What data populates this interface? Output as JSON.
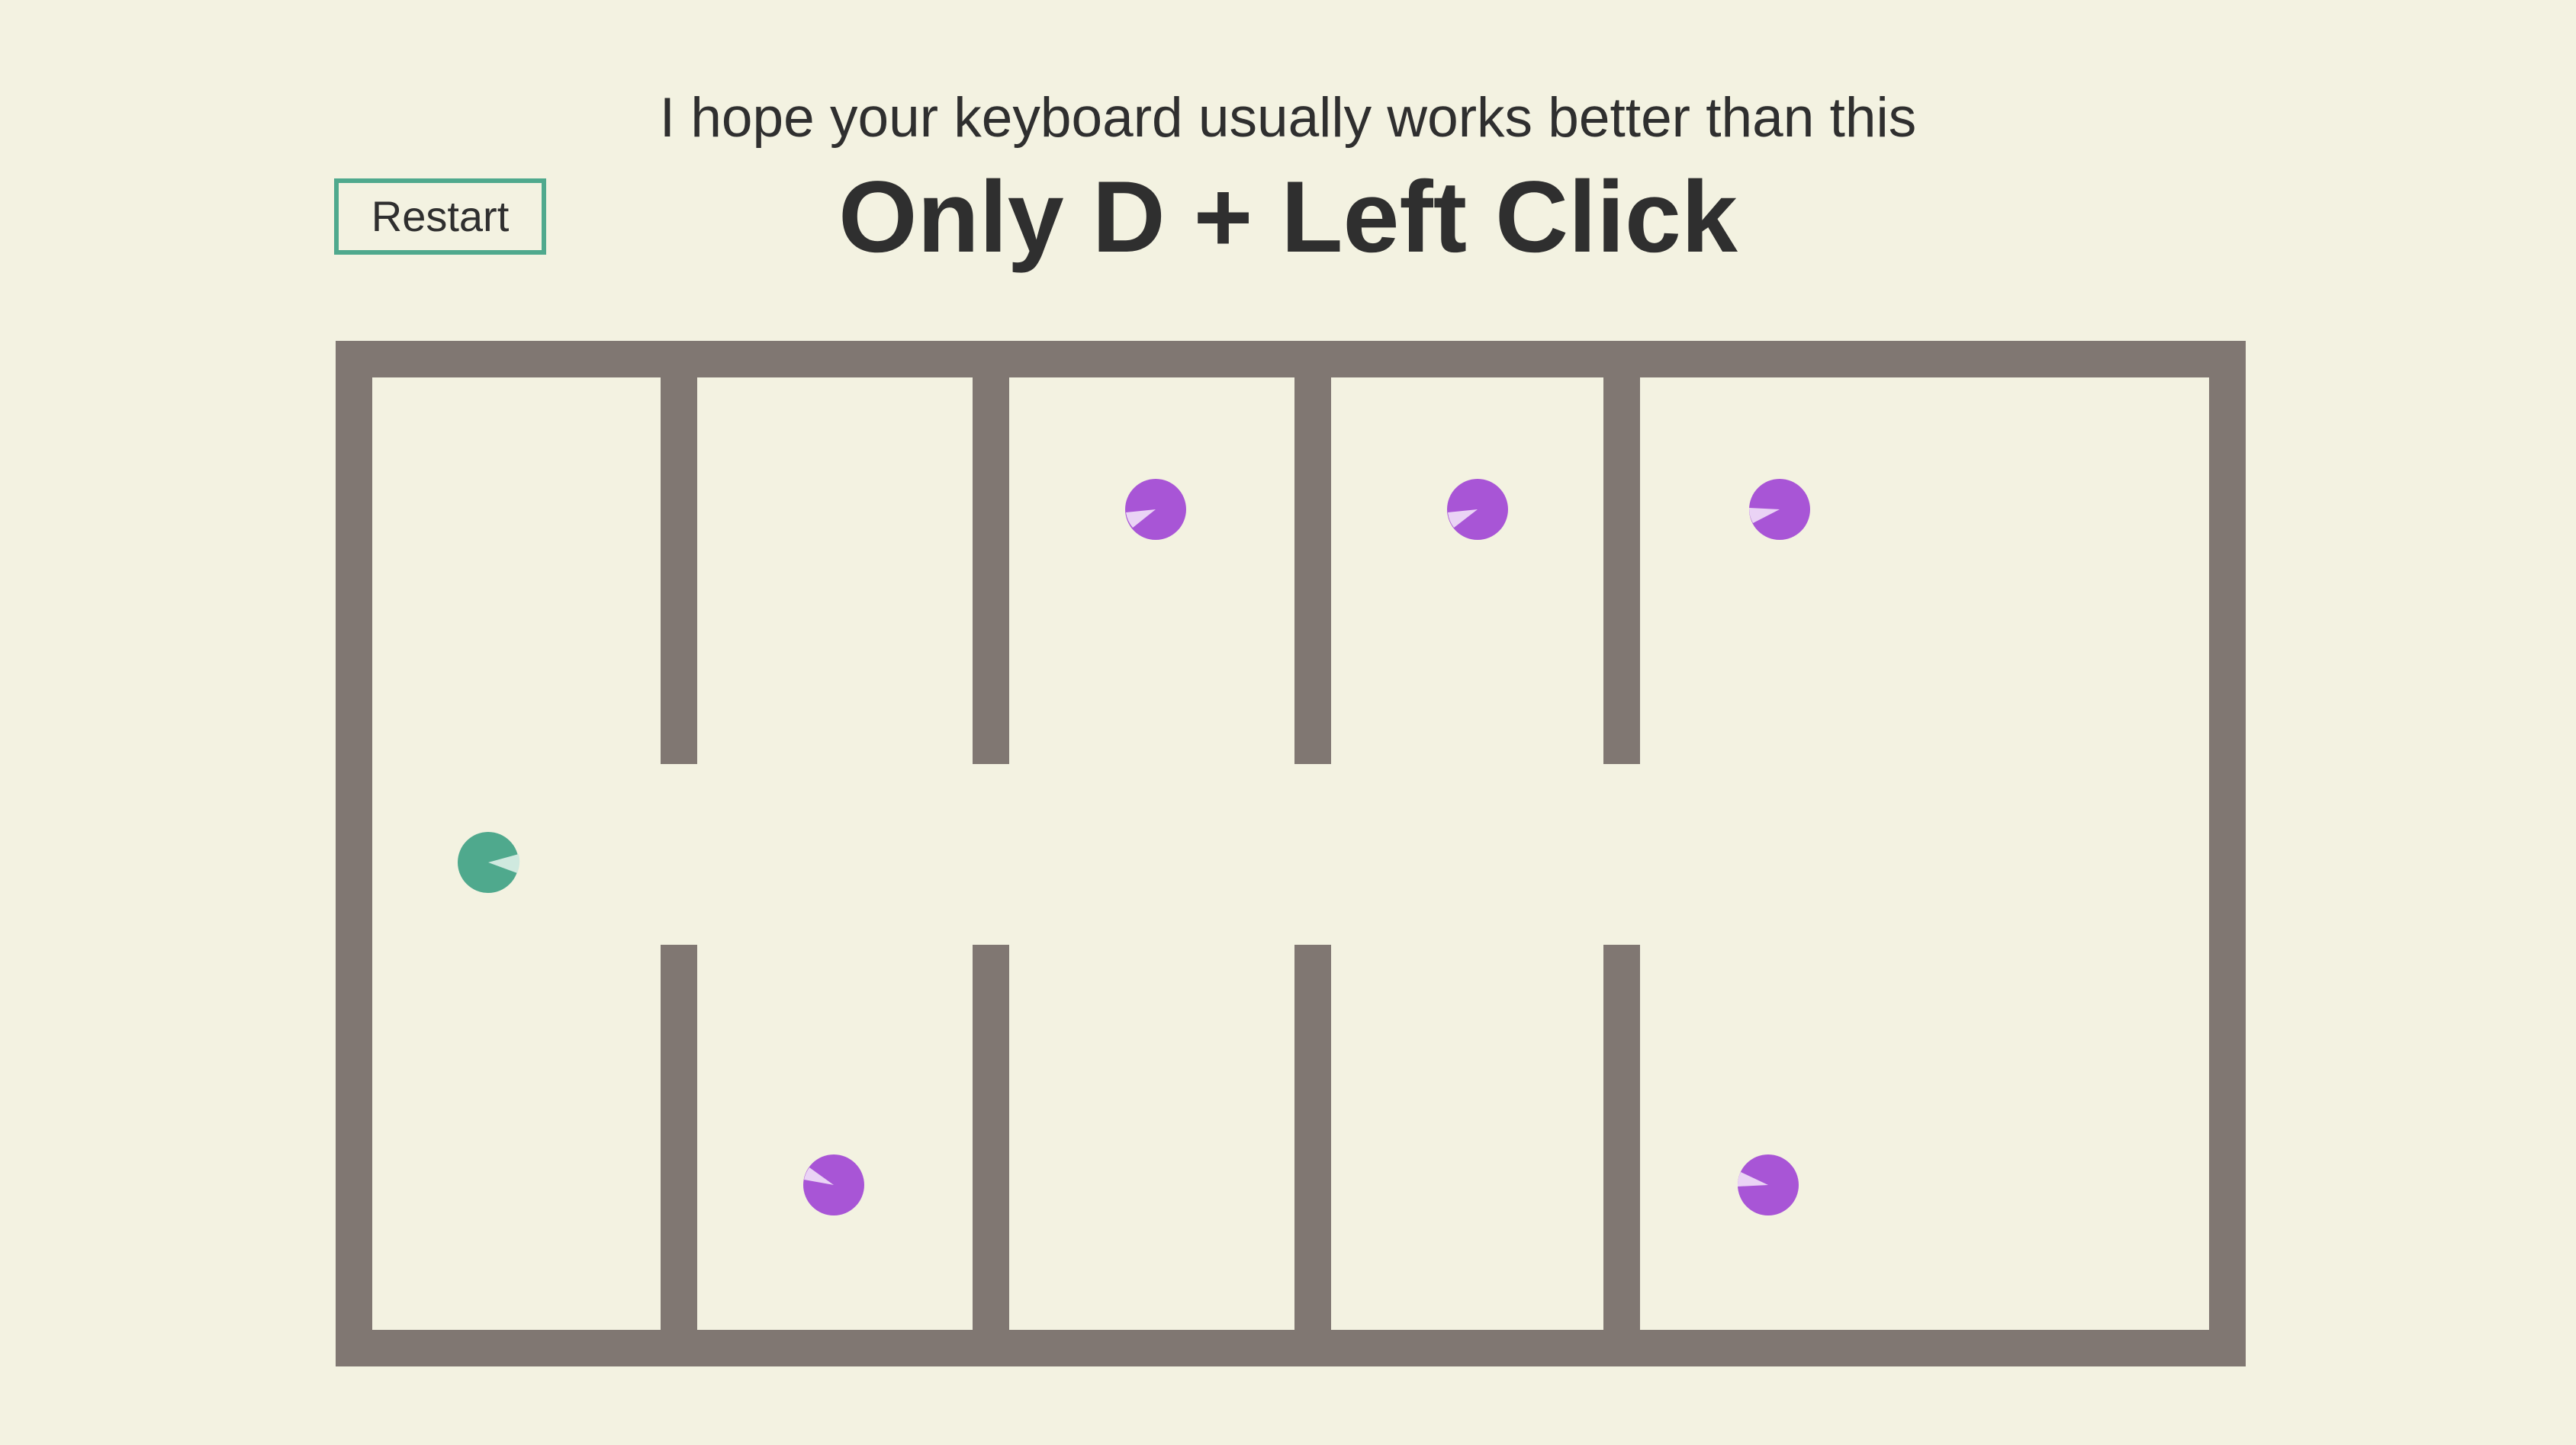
{
  "header": {
    "subtitle": "I hope your keyboard usually works better than this",
    "title": "Only D + Left Click"
  },
  "controls": {
    "restart_label": "Restart"
  },
  "colors": {
    "background": "#f3f2e1",
    "wall": "#807772",
    "player": "#4fa98d",
    "player_mouth": "#cfe9df",
    "enemy": "#a855d6",
    "enemy_mouth": "#ead3f5",
    "text": "#2f2f2f"
  },
  "game": {
    "player": {
      "name": "player",
      "facing": "right"
    },
    "enemies": [
      {
        "name": "enemy-room-3-top",
        "facing": "down-left"
      },
      {
        "name": "enemy-room-4-top",
        "facing": "down-left"
      },
      {
        "name": "enemy-room-5-top",
        "facing": "left"
      },
      {
        "name": "enemy-room-2-bottom",
        "facing": "up-left"
      },
      {
        "name": "enemy-room-5-bottom",
        "facing": "left"
      }
    ]
  }
}
